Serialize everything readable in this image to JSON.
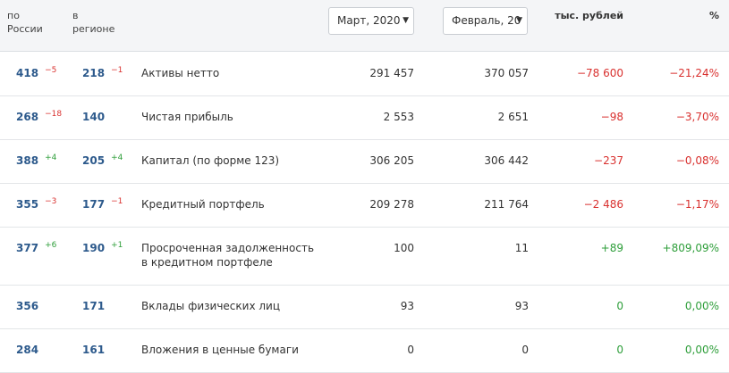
{
  "header": {
    "col_russia": "по\nРоссии",
    "col_region": "в\nрегионе",
    "period_current": "Март, 2020",
    "period_previous": "Февраль, 20",
    "unit_label": "тыс. рублей",
    "percent_label": "%"
  },
  "rows": [
    {
      "rank_russia": "418",
      "rank_russia_delta": "−5",
      "rank_region": "218",
      "rank_region_delta": "−1",
      "name": "Активы нетто",
      "value_current": "291 457",
      "value_previous": "370 057",
      "change_abs": "−78 600",
      "change_pct": "−21,24%",
      "trend": "neg"
    },
    {
      "rank_russia": "268",
      "rank_russia_delta": "−18",
      "rank_region": "140",
      "rank_region_delta": "",
      "name": "Чистая прибыль",
      "value_current": "2 553",
      "value_previous": "2 651",
      "change_abs": "−98",
      "change_pct": "−3,70%",
      "trend": "neg"
    },
    {
      "rank_russia": "388",
      "rank_russia_delta": "+4",
      "rank_region": "205",
      "rank_region_delta": "+4",
      "name": "Капитал (по форме 123)",
      "value_current": "306 205",
      "value_previous": "306 442",
      "change_abs": "−237",
      "change_pct": "−0,08%",
      "trend": "neg"
    },
    {
      "rank_russia": "355",
      "rank_russia_delta": "−3",
      "rank_region": "177",
      "rank_region_delta": "−1",
      "name": "Кредитный портфель",
      "value_current": "209 278",
      "value_previous": "211 764",
      "change_abs": "−2 486",
      "change_pct": "−1,17%",
      "trend": "neg"
    },
    {
      "rank_russia": "377",
      "rank_russia_delta": "+6",
      "rank_region": "190",
      "rank_region_delta": "+1",
      "name": "Просроченная задолженность\nв кредитном портфеле",
      "value_current": "100",
      "value_previous": "11",
      "change_abs": "+89",
      "change_pct": "+809,09%",
      "trend": "pos"
    },
    {
      "rank_russia": "356",
      "rank_russia_delta": "",
      "rank_region": "171",
      "rank_region_delta": "",
      "name": "Вклады физических лиц",
      "value_current": "93",
      "value_previous": "93",
      "change_abs": "0",
      "change_pct": "0,00%",
      "trend": "pos"
    },
    {
      "rank_russia": "284",
      "rank_russia_delta": "",
      "rank_region": "161",
      "rank_region_delta": "",
      "name": "Вложения в ценные бумаги",
      "value_current": "0",
      "value_previous": "0",
      "change_abs": "0",
      "change_pct": "0,00%",
      "trend": "pos"
    }
  ],
  "colors": {
    "negative": "#d9312f",
    "positive": "#2e9e3a",
    "rank": "#2d5a8c"
  }
}
